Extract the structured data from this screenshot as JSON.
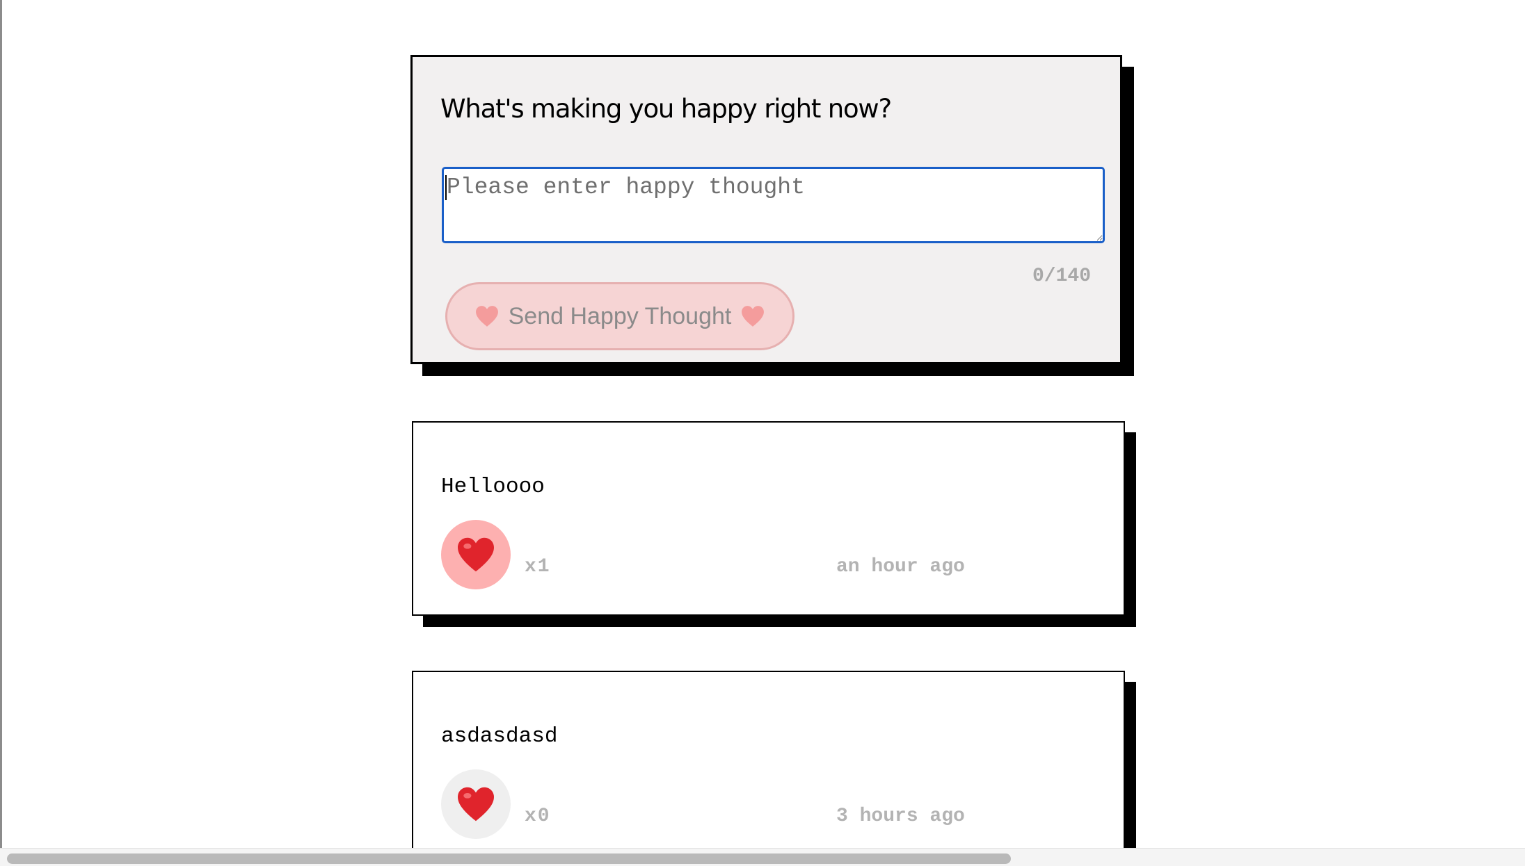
{
  "form": {
    "question": "What's making you happy right now?",
    "input_placeholder": "Please enter happy thought",
    "input_value": "",
    "char_count": "0/140",
    "send_button_label": "Send Happy Thought"
  },
  "thoughts": [
    {
      "message": "Helloooo",
      "likes": "x1",
      "time": "an hour ago",
      "liked": true
    },
    {
      "message": "asdasdasd",
      "likes": "x0",
      "time": "3 hours ago",
      "liked": false
    }
  ],
  "icons": {
    "heart": "heart-icon"
  },
  "colors": {
    "input_border": "#1a5fc8",
    "send_button_bg": "#f6d4d4",
    "liked_bg": "#fdb0b0",
    "unliked_bg": "#efefef",
    "heart": "#e0242c",
    "muted_text": "#b3b3b3"
  }
}
